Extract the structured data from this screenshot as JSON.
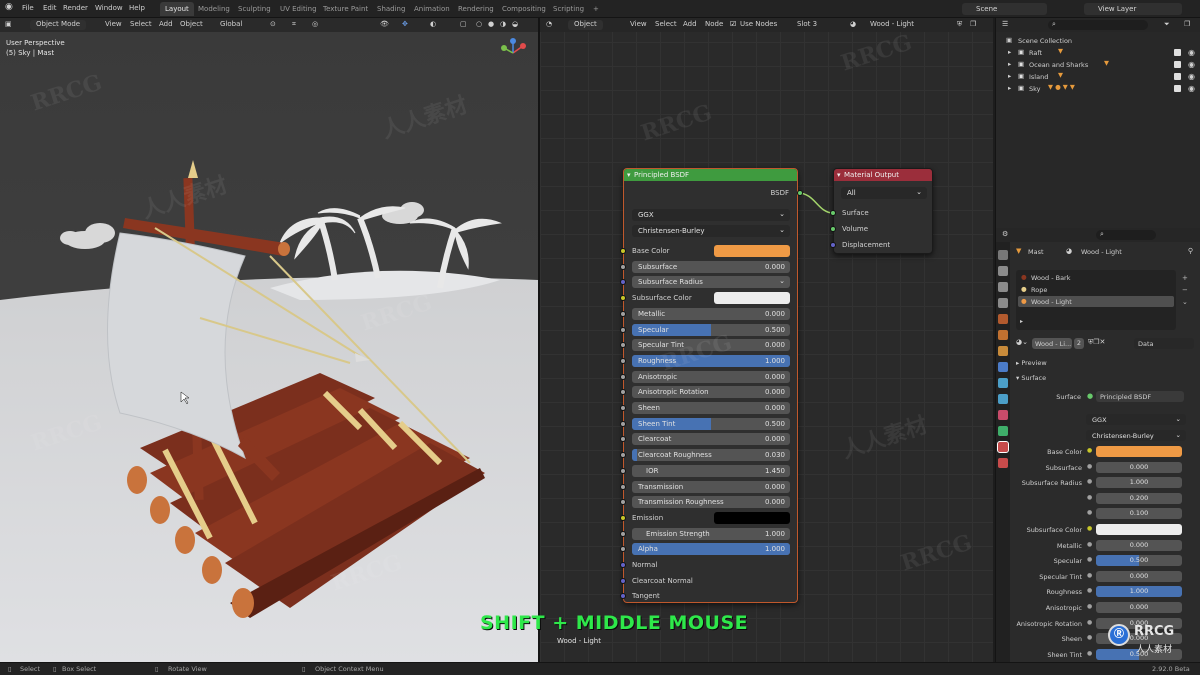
{
  "topbar": {
    "menus": [
      "File",
      "Edit",
      "Render",
      "Window",
      "Help"
    ],
    "workspaces": [
      "Layout",
      "Modeling",
      "Sculpting",
      "UV Editing",
      "Texture Paint",
      "Shading",
      "Animation",
      "Rendering",
      "Compositing",
      "Scripting",
      "+"
    ],
    "active_workspace": "Layout",
    "scene": "Scene",
    "view_layer": "View Layer"
  },
  "viewport": {
    "mode": "Object Mode",
    "menus": [
      "View",
      "Select",
      "Add",
      "Object"
    ],
    "transform_orientation": "Global",
    "info_line1": "User Perspective",
    "info_line2": "(5) Sky | Mast"
  },
  "node_editor": {
    "type": "Object",
    "menus": [
      "View",
      "Select",
      "Add",
      "Node"
    ],
    "use_nodes_label": "Use Nodes",
    "slot": "Slot 3",
    "material": "Wood - Light",
    "bottom_label": "Wood - Light",
    "principled": {
      "title": "Principled BSDF",
      "output": "BSDF",
      "distribution": "GGX",
      "subsurface_method": "Christensen-Burley",
      "rows": [
        {
          "label": "Base Color",
          "kind": "color",
          "color": "#ef9a45",
          "socket": "#c7c729"
        },
        {
          "label": "Subsurface",
          "kind": "num",
          "value": "0.000",
          "fill": 0,
          "socket": "#a1a1a1"
        },
        {
          "label": "Subsurface Radius",
          "kind": "dropdown",
          "socket": "#6363c7"
        },
        {
          "label": "Subsurface Color",
          "kind": "color",
          "color": "#ededed",
          "socket": "#c7c729"
        },
        {
          "label": "Metallic",
          "kind": "num",
          "value": "0.000",
          "fill": 0,
          "socket": "#a1a1a1"
        },
        {
          "label": "Specular",
          "kind": "num",
          "value": "0.500",
          "fill": 0.5,
          "socket": "#a1a1a1"
        },
        {
          "label": "Specular Tint",
          "kind": "num",
          "value": "0.000",
          "fill": 0,
          "socket": "#a1a1a1"
        },
        {
          "label": "Roughness",
          "kind": "num",
          "value": "1.000",
          "fill": 1,
          "socket": "#a1a1a1"
        },
        {
          "label": "Anisotropic",
          "kind": "num",
          "value": "0.000",
          "fill": 0,
          "socket": "#a1a1a1"
        },
        {
          "label": "Anisotropic Rotation",
          "kind": "num",
          "value": "0.000",
          "fill": 0,
          "socket": "#a1a1a1"
        },
        {
          "label": "Sheen",
          "kind": "num",
          "value": "0.000",
          "fill": 0,
          "socket": "#a1a1a1"
        },
        {
          "label": "Sheen Tint",
          "kind": "num",
          "value": "0.500",
          "fill": 0.5,
          "socket": "#a1a1a1"
        },
        {
          "label": "Clearcoat",
          "kind": "num",
          "value": "0.000",
          "fill": 0,
          "socket": "#a1a1a1"
        },
        {
          "label": "Clearcoat Roughness",
          "kind": "num",
          "value": "0.030",
          "fill": 0.03,
          "socket": "#a1a1a1"
        },
        {
          "label": "IOR",
          "kind": "num",
          "value": "1.450",
          "fill": 0,
          "socket": "#a1a1a1"
        },
        {
          "label": "Transmission",
          "kind": "num",
          "value": "0.000",
          "fill": 0,
          "socket": "#a1a1a1"
        },
        {
          "label": "Transmission Roughness",
          "kind": "num",
          "value": "0.000",
          "fill": 0,
          "socket": "#a1a1a1"
        },
        {
          "label": "Emission",
          "kind": "color",
          "color": "#000000",
          "socket": "#c7c729"
        },
        {
          "label": "Emission Strength",
          "kind": "num",
          "value": "1.000",
          "fill": 0,
          "socket": "#a1a1a1"
        },
        {
          "label": "Alpha",
          "kind": "num",
          "value": "1.000",
          "fill": 1,
          "socket": "#a1a1a1"
        },
        {
          "label": "Normal",
          "kind": "socket",
          "socket": "#6363c7"
        },
        {
          "label": "Clearcoat Normal",
          "kind": "socket",
          "socket": "#6363c7"
        },
        {
          "label": "Tangent",
          "kind": "socket",
          "socket": "#6363c7"
        }
      ]
    },
    "output_node": {
      "title": "Material Output",
      "target": "All",
      "inputs": [
        "Surface",
        "Volume",
        "Displacement"
      ]
    }
  },
  "overlay": "SHIFT + MIDDLE MOUSE",
  "outliner": {
    "root": "Scene Collection",
    "items": [
      "Raft",
      "Ocean and Sharks",
      "Island",
      "Sky"
    ]
  },
  "properties": {
    "object": "Mast",
    "material": "Wood - Light",
    "slots": [
      "Wood - Bark",
      "Rope",
      "Wood - Light"
    ],
    "material_field": "Wood - Li...",
    "users": "2",
    "link": "Data",
    "preview_label": "Preview",
    "surface_label": "Surface",
    "surface_shader": "Principled BSDF",
    "distribution": "GGX",
    "subsurface_method": "Christensen-Burley",
    "rows": [
      {
        "label": "Base Color",
        "kind": "color",
        "color": "#ef9a45"
      },
      {
        "label": "Subsurface",
        "value": "0.000",
        "fill": 0
      },
      {
        "label": "Subsurface Radius",
        "value": "1.000",
        "fill": 0
      },
      {
        "label": "",
        "value": "0.200",
        "fill": 0
      },
      {
        "label": "",
        "value": "0.100",
        "fill": 0
      },
      {
        "label": "Subsurface Color",
        "kind": "color",
        "color": "#ededed"
      },
      {
        "label": "Metallic",
        "value": "0.000",
        "fill": 0
      },
      {
        "label": "Specular",
        "value": "0.500",
        "fill": 0.5
      },
      {
        "label": "Specular Tint",
        "value": "0.000",
        "fill": 0
      },
      {
        "label": "Roughness",
        "value": "1.000",
        "fill": 1
      },
      {
        "label": "Anisotropic",
        "value": "0.000",
        "fill": 0
      },
      {
        "label": "Anisotropic Rotation",
        "value": "0.000",
        "fill": 0
      },
      {
        "label": "Sheen",
        "value": "0.000",
        "fill": 0
      },
      {
        "label": "Sheen Tint",
        "value": "0.500",
        "fill": 0.5
      }
    ]
  },
  "statusbar": {
    "select": "Select",
    "box_select": "Box Select",
    "rotate_view": "Rotate View",
    "context_menu": "Object Context Menu",
    "version": "2.92.0 Beta"
  },
  "watermark": "RRCG",
  "watermark_cn": "人人素材",
  "logo_text": "RRCG",
  "logo_sub": "人人素材"
}
